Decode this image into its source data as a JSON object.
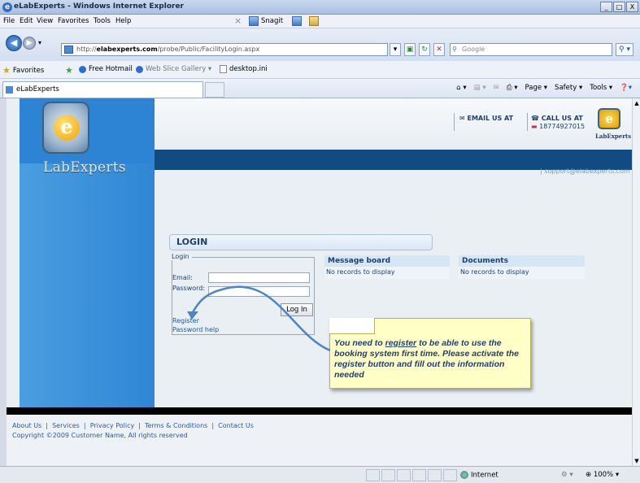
{
  "window": {
    "title": "eLabExperts - Windows Internet Explorer",
    "controls": [
      "_",
      "□",
      "X"
    ]
  },
  "menubar": {
    "items": [
      "File",
      "Edit",
      "View",
      "Favorites",
      "Tools",
      "Help"
    ],
    "snagit_label": "Snagit"
  },
  "address": {
    "url_prefix": "http://",
    "url_host": "elabexperts.com",
    "url_path": "/probe/Public/FacilityLogin.aspx",
    "search_placeholder": "Google"
  },
  "favorites": {
    "label": "Favorites",
    "items": [
      "Free Hotmail",
      "Web Slice Gallery ▾",
      "desktop.ini"
    ]
  },
  "tab": {
    "title": "eLabExperts"
  },
  "commandbar": {
    "items": [
      "Page ▾",
      "Safety ▾",
      "Tools ▾"
    ]
  },
  "site": {
    "brand": "LabExperts",
    "email_us": "EMAIL US AT",
    "call_us": "CALL US AT",
    "phone": "18774927015",
    "mini_brand": "LabExperts",
    "support_email": "support@elabexperts.com"
  },
  "login": {
    "heading": "LOGIN",
    "legend": "Login",
    "email_label": "Email:",
    "password_label": "Password:",
    "button": "Log In",
    "register_link": "Register",
    "password_help_link": "Password help"
  },
  "message_board": {
    "heading": "Message board",
    "empty": "No records to display"
  },
  "documents": {
    "heading": "Documents",
    "empty": "No records to display"
  },
  "callout": {
    "text_before": "You need to ",
    "text_underlined": "register",
    "text_after": " to be able to use the booking system first time. Please activate the register button and fill out the information needed"
  },
  "footer": {
    "links": "About Us  |  Services  |  Privacy Policy  |  Terms & Conditions  |  Contact Us",
    "copyright": "Copyright ©2009 Customer Name, All rights reserved"
  },
  "status": {
    "zone": "Internet",
    "zoom": "100%"
  }
}
